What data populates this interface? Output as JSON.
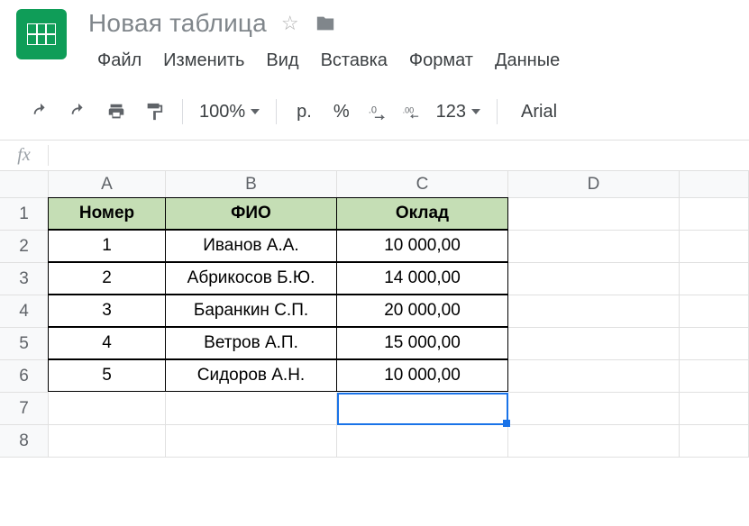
{
  "header": {
    "title": "Новая таблица",
    "menus": [
      "Файл",
      "Изменить",
      "Вид",
      "Вставка",
      "Формат",
      "Данные"
    ]
  },
  "toolbar": {
    "zoom": "100%",
    "currency": "р.",
    "percent": "%",
    "dec_less": ".0",
    "dec_more": ".00",
    "more_formats": "123",
    "font": "Arial"
  },
  "formula": "",
  "columns": [
    "A",
    "B",
    "C",
    "D"
  ],
  "rows": [
    "1",
    "2",
    "3",
    "4",
    "5",
    "6",
    "7",
    "8"
  ],
  "table": {
    "headers": [
      "Номер",
      "ФИО",
      "Оклад"
    ],
    "data": [
      [
        "1",
        "Иванов А.А.",
        "10 000,00"
      ],
      [
        "2",
        "Абрикосов Б.Ю.",
        "14 000,00"
      ],
      [
        "3",
        "Баранкин С.П.",
        "20 000,00"
      ],
      [
        "4",
        "Ветров А.П.",
        "15 000,00"
      ],
      [
        "5",
        "Сидоров А.Н.",
        "10 000,00"
      ]
    ]
  },
  "selected_cell": "C7"
}
